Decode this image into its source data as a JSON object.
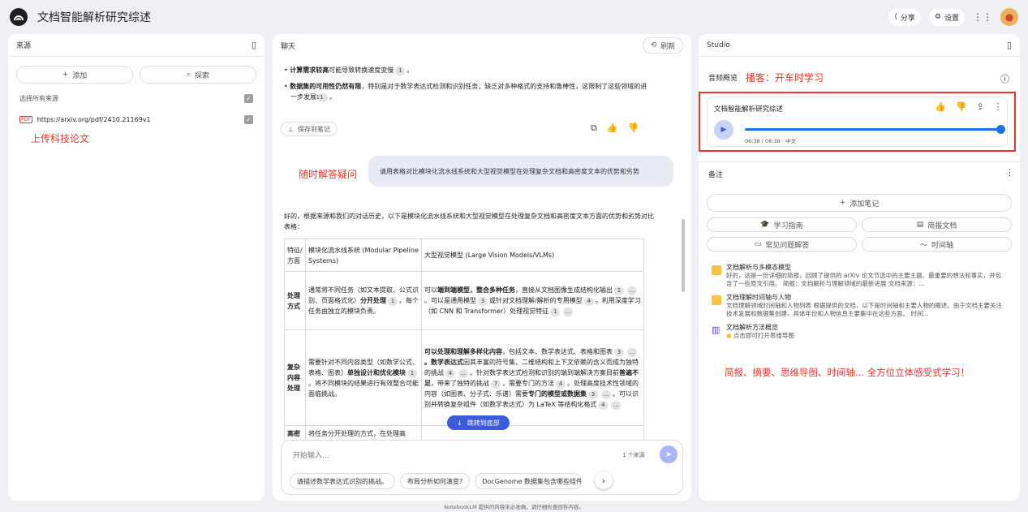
{
  "header": {
    "title": "文档智能解析研究综述",
    "share_label": "分享",
    "settings_label": "设置"
  },
  "sources": {
    "title": "来源",
    "add_label": "添加",
    "explore_label": "探索",
    "select_all_label": "选择所有来源",
    "items": [
      {
        "label": "https://arxiv.org/pdf/2410.21169v1"
      }
    ],
    "annotation": "上传科技论文"
  },
  "chat": {
    "title": "聊天",
    "refresh_label": "刷新",
    "bullet1_bold": "计算需求较高",
    "bullet1_rest": "可能导致转换速度变慢",
    "bullet1_cite": "1",
    "bullet2_bold": "数据集的可用性仍然有限",
    "bullet2_rest": "，特别是对于数学表达式检测和识别任务，缺乏对多种格式的支持和鲁棒性，这限制了这些领域的进一步发展",
    "bullet2_cite": "11",
    "save_note_label": "保存到笔记",
    "annotation": "随时解答疑问",
    "user_message": "请用表格对比模块化流水线系统和大型视觉模型在处理复杂文档和高密度文本的优势和劣势",
    "answer_intro": "好的，根据来源和我们的对话历史，以下是模块化流水线系统和大型视觉模型在处理复杂文档和高密度文本方面的优势和劣势对比表格：",
    "table": {
      "h1": "特征/方面",
      "h2": "模块化流水线系统 (Modular Pipeline Systems)",
      "h3": "大型视觉模型 (Large Vision Models/VLMs)",
      "r1_label": "处理方式",
      "r1_c2a": "通常将不同任务（如文本提取、公式识别、页面格式化）",
      "r1_c2b": "分开处理",
      "r1_c2c": "。每个任务由独立的模块负责。",
      "r1_c3a": "可以",
      "r1_c3b": "端到端",
      "r1_c3c": "模型，",
      "r1_c3d": "整合多种任务",
      "r1_c3e": "，直接从文档图像生成结构化输出",
      "r1_c3f": "。可以是通用模型",
      "r1_c3g": "或针对文档理解/解析的专用模型",
      "r1_c3h": "。利用深度学习（如 CNN 和 Transformer）处理视觉特征",
      "r2_label": "复杂内容处理",
      "r2_c2a": "需要针对不同内容类型（如数学公式、表格、图表）",
      "r2_c2b": "单独设计和优化模块",
      "r2_c2c": "。将不同模块的结果进行有效整合可能面临挑战。",
      "r2_c3a": "可以处理和理解多样化内容",
      "r2_c3b": "，包括文本、数学表达式、表格和图表",
      "r2_c3c": "。数学表达式",
      "r2_c3d": "因其丰富的符号集、二维结构和上下文依赖的含义而成为独特的挑战",
      "r2_c3e": "。针对数学表达式检测和识别的端到端解决方案目前",
      "r2_c3f": "普遍不足",
      "r2_c3g": "，带来了独特的挑战",
      "r2_c3h": "，需要专门的方法",
      "r2_c3i": "。处理高度技术性领域的内容（如图表、分子式、乐谱）需要",
      "r2_c3j": "专门的模型或数据集",
      "r2_c3k": "。可以识别并转换复杂组件（如数学表达式）为 LaTeX 等结构化格式",
      "r3_label": "高密",
      "r3_c2": "将任务分开处理的方式，在处理高"
    },
    "jump_label": "跳转到底部",
    "input_placeholder": "开始输入...",
    "source_count": "1 个来源",
    "suggestions": [
      "请描述数学表达式识别的挑战。",
      "布局分析如何演变?",
      "DocGenome 数据集包含哪些组件"
    ]
  },
  "studio": {
    "title": "Studio",
    "audio_label": "音频概览",
    "audio_annotation": "播客：开车时学习",
    "audio_title": "文档智能解析研究综述",
    "audio_time": "06:38 / 06:38 · 中文",
    "audio_progress": 1.0,
    "notes_title": "备注",
    "add_note_label": "添加笔记",
    "quick": [
      "学习指南",
      "简报文档",
      "常见问题解答",
      "时间轴"
    ],
    "notes": [
      {
        "title": "文档解析与多模态模型",
        "snippet": "好的，这是一份详细的简报，回顾了提供的 arXiv 论文节选中的主要主题、最重要的想法和事实，并包含了一些原文引用。 简报：文档解析与理解领域的最新进展 文档来源：..."
      },
      {
        "title": "文档理解时间轴与人物",
        "snippet": "文档理解领域时间轴和人物列表 根据提供的文档，以下是时间轴和主要人物的概述。由于文档主要关注技术发展和数据集创建，具体年份和人物信息主要集中在这些方面。 时间..."
      },
      {
        "title": "文档解析方法概览",
        "snippet": "点击即可打开思维导图"
      }
    ],
    "annotation": "简报、摘要、思维导图、时间轴... 全方位立体感受式学习！"
  },
  "footer": "NotebookLM 提供的内容未必准确，请仔细检查回答内容。",
  "colors": {
    "accent": "#1a73e8",
    "annotation": "#e8342b",
    "background": "#eef0f3"
  }
}
